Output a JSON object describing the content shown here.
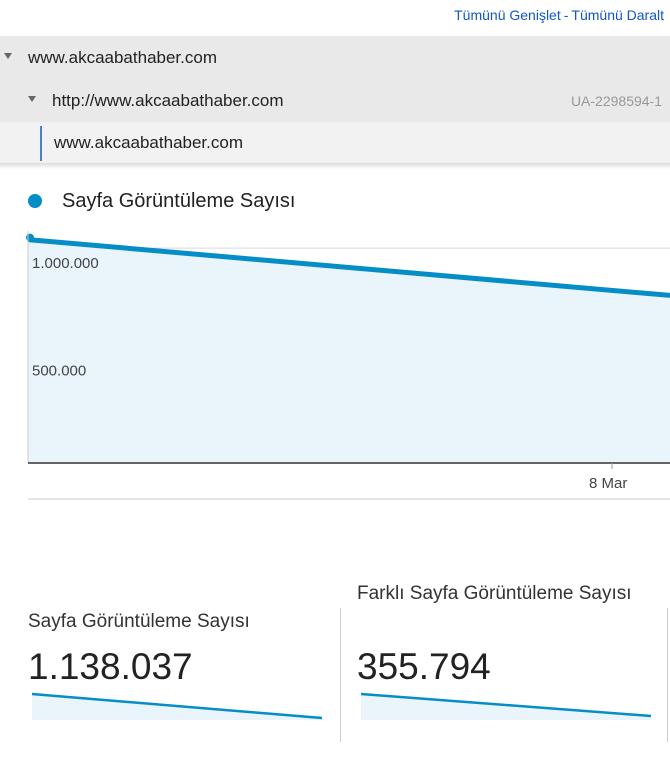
{
  "header": {
    "expand_all": "Tümünü Genişlet",
    "separator": "-",
    "collapse_all": "Tümünü Daralt"
  },
  "tree": {
    "account": "www.akcaabathaber.com",
    "property": "http://www.akcaabathaber.com",
    "property_id": "UA-2298594-1",
    "view": "www.akcaabathaber.com"
  },
  "legend": {
    "label": "Sayfa Görüntüleme Sayısı",
    "color": "#058dc7"
  },
  "chart_data": {
    "type": "area",
    "series": [
      {
        "name": "Sayfa Görüntüleme Sayısı",
        "x": [
          "",
          "8 Mar"
        ],
        "values": [
          1040000,
          780000
        ]
      }
    ],
    "x_tick_labels": [
      "8 Mar"
    ],
    "y_tick_labels": [
      "1.000.000",
      "500.000"
    ],
    "y_ticks": [
      1000000,
      500000
    ],
    "ylim": [
      0,
      1000000
    ],
    "grid": true,
    "line_color": "#058dc7",
    "fill_color": "#e9f4fb"
  },
  "metrics": [
    {
      "label": "Sayfa Görüntüleme Sayısı",
      "value": "1.138.037"
    },
    {
      "label": "Farklı Sayfa Görüntüleme Sayısı",
      "value": "355.794"
    }
  ]
}
